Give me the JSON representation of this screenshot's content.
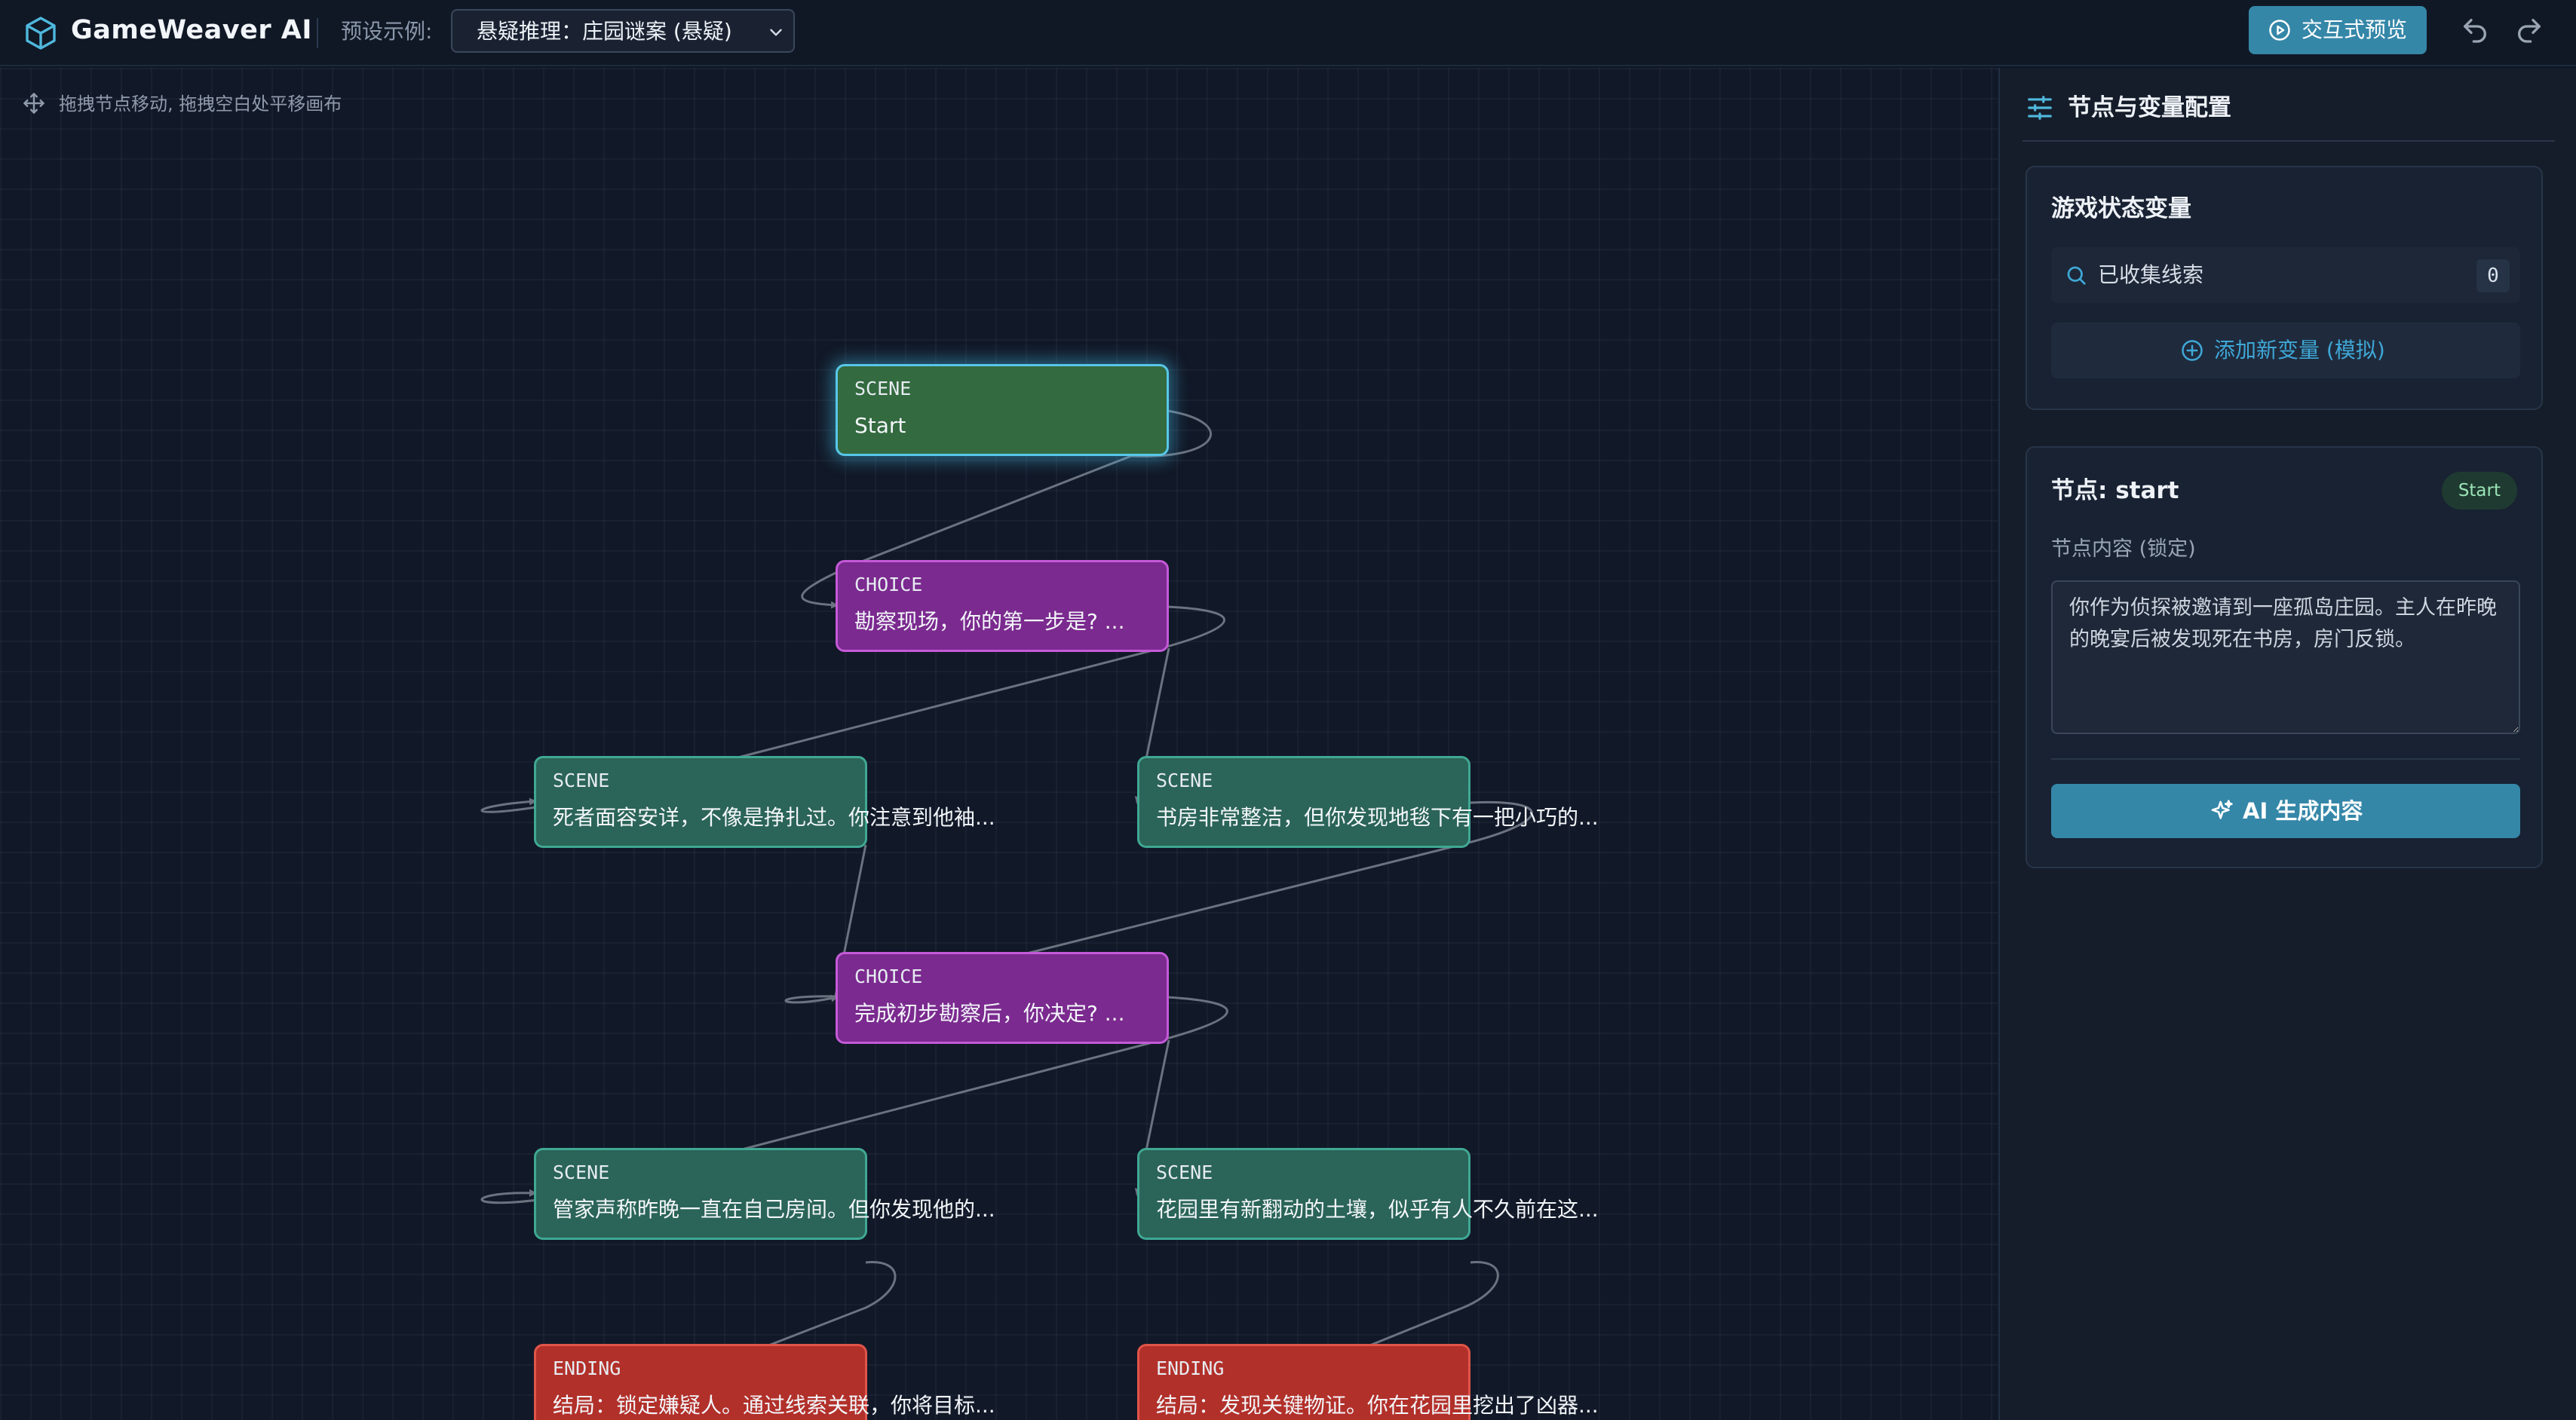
{
  "header": {
    "app_title": "GameWeaver AI",
    "preset_label": "预设示例:",
    "preset_selected": "悬疑推理：庄园谜案 (悬疑)",
    "preview_label": "交互式预览",
    "icons": [
      "cube-logo-icon",
      "chevron-down-icon",
      "play-circle-icon",
      "undo-icon",
      "redo-icon"
    ]
  },
  "canvas": {
    "hint": "拖拽节点移动, 拖拽空白处平移画布",
    "nodes": [
      {
        "id": "start",
        "type": "SCENE",
        "text": "Start"
      },
      {
        "id": "choice1",
        "type": "CHOICE",
        "text": "勘察现场，你的第一步是? ..."
      },
      {
        "id": "scene_body",
        "type": "SCENE",
        "text": "死者面容安详，不像是挣扎过。你注意到他袖..."
      },
      {
        "id": "scene_study",
        "type": "SCENE",
        "text": "书房非常整洁，但你发现地毯下有一把小巧的..."
      },
      {
        "id": "choice2",
        "type": "CHOICE",
        "text": "完成初步勘察后，你决定? ..."
      },
      {
        "id": "scene_butler",
        "type": "SCENE",
        "text": "管家声称昨晚一直在自己房间。但你发现他的..."
      },
      {
        "id": "scene_garden",
        "type": "SCENE",
        "text": "花园里有新翻动的土壤，似乎有人不久前在这..."
      },
      {
        "id": "ending1",
        "type": "ENDING",
        "text": "结局：锁定嫌疑人。通过线索关联，你将目标..."
      },
      {
        "id": "ending2",
        "type": "ENDING",
        "text": "结局：发现关键物证。你在花园里挖出了凶器..."
      }
    ],
    "edges": [
      [
        "start",
        "choice1"
      ],
      [
        "choice1",
        "scene_body"
      ],
      [
        "choice1",
        "scene_study"
      ],
      [
        "scene_body",
        "choice2"
      ],
      [
        "scene_study",
        "choice2"
      ],
      [
        "choice2",
        "scene_butler"
      ],
      [
        "choice2",
        "scene_garden"
      ],
      [
        "scene_butler",
        "ending1"
      ],
      [
        "scene_garden",
        "ending2"
      ]
    ],
    "selected_node": "start",
    "colors": {
      "scene": "#2b6458",
      "choice": "#7b2a8f",
      "ending": "#b2302a",
      "start": "#336a3f",
      "selection_glow": "#58c7e8",
      "edge": "#6b7280"
    }
  },
  "panel": {
    "title": "节点与变量配置",
    "variables": {
      "heading": "游戏状态变量",
      "items": [
        {
          "name": "已收集线索",
          "value": "0"
        }
      ],
      "add_label": "添加新变量 (模拟)"
    },
    "node": {
      "heading": "节点: start",
      "badge": "Start",
      "content_label": "节点内容 (锁定)",
      "content": "你作为侦探被邀请到一座孤岛庄园。主人在昨晚的晚宴后被发现死在书房，房门反锁。",
      "ai_label": "AI 生成内容"
    }
  },
  "colors": {
    "accent": "#3587a8",
    "link": "#3fa7d6",
    "background": "#111827"
  }
}
